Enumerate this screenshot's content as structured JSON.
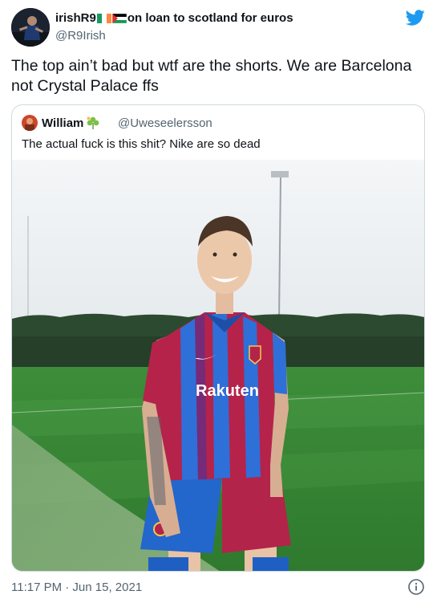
{
  "author": {
    "name": "irishR9",
    "name_suffix": "on loan to scotland for euros",
    "handle": "@R9Irish",
    "avatar_icon": "person-photo-avatar"
  },
  "tweet": {
    "text": "The top ain’t bad but wtf are the shorts. We are Barcelona not Crystal Palace ffs"
  },
  "quoted": {
    "name": "William",
    "handle": "@Uweseelersson",
    "text": "The actual fuck is this shit? Nike are so dead",
    "photo": {
      "description_icon": "football-player-photo",
      "shirt_sponsor": "Rakuten"
    }
  },
  "meta": {
    "timestamp": "11:17 PM · Jun 15, 2021"
  },
  "icons": {
    "brand": "twitter-bird-icon",
    "info": "info-icon"
  },
  "colors": {
    "twitter_blue": "#1d9bf0",
    "text_primary": "#0f1419",
    "text_secondary": "#536471",
    "border": "#cfd9de",
    "barca_blue": "#2f6fd8",
    "barca_red": "#b5234a"
  }
}
